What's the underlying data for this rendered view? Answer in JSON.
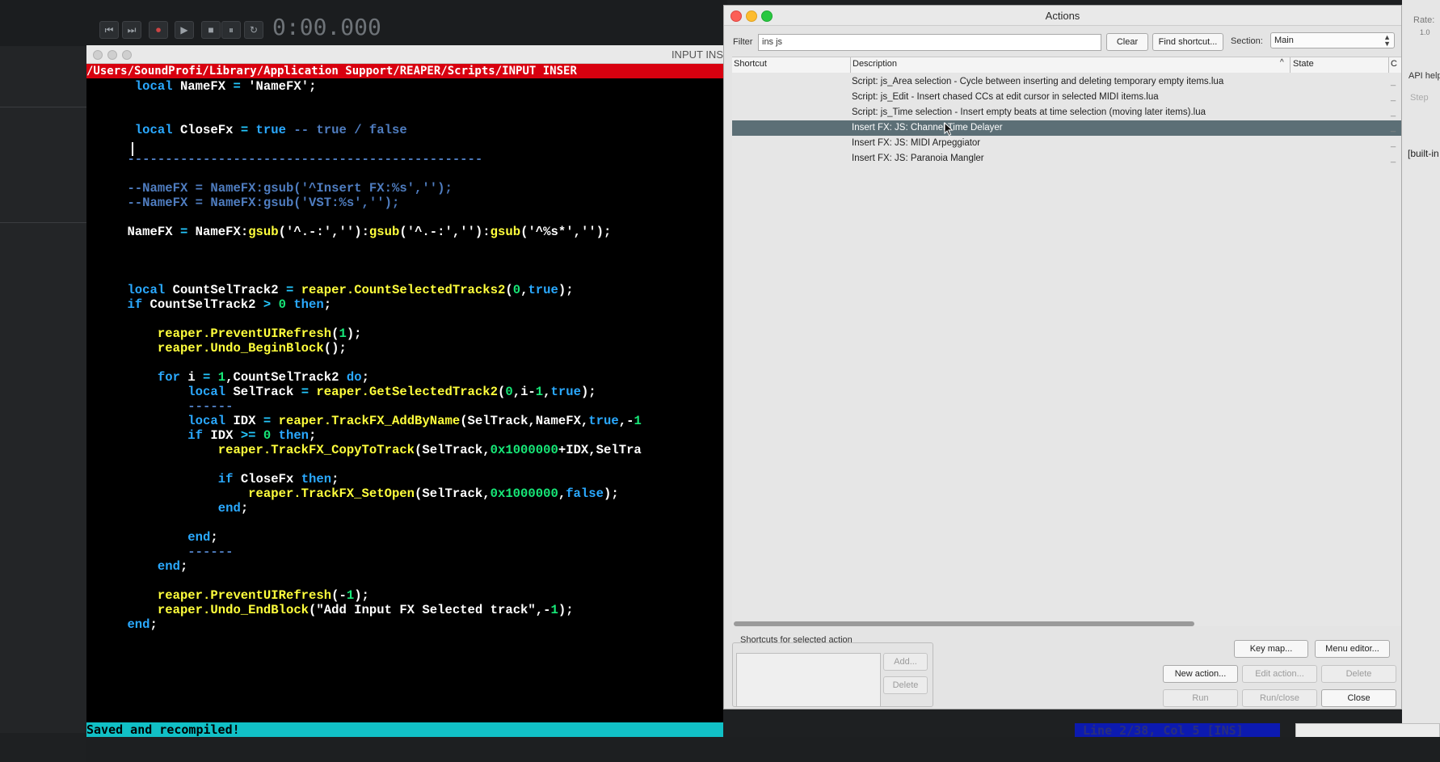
{
  "transport": {
    "time": "0:00.000",
    "buttons": [
      "⏮",
      "⏭",
      "⏺",
      "▶",
      "■",
      "⏸",
      "↻"
    ]
  },
  "editor": {
    "title": "INPUT INS",
    "path": "/Users/SoundProfi/Library/Application Support/REAPER/Scripts/INPUT INSER",
    "status_left": "Saved and recompiled!",
    "status_right": "Line 2/38, Col 5 [INS]"
  },
  "code_lines": [
    {
      "indent": "     ",
      "parts": [
        [
          "kw",
          "local "
        ],
        [
          "st",
          "NameFX "
        ],
        [
          "op",
          "= "
        ],
        [
          "st",
          "'NameFX'"
        ],
        [
          "st",
          ";"
        ]
      ]
    },
    {
      "indent": "",
      "parts": []
    },
    {
      "indent": "",
      "parts": []
    },
    {
      "indent": "     ",
      "parts": [
        [
          "kw",
          "local "
        ],
        [
          "st",
          "CloseFx "
        ],
        [
          "op",
          "= "
        ],
        [
          "kw",
          "true "
        ],
        [
          "cm",
          "-- true / false"
        ]
      ]
    },
    {
      "indent": "",
      "parts": []
    },
    {
      "indent": "    ",
      "parts": [
        [
          "cm",
          "-----------------------------------------------"
        ]
      ]
    },
    {
      "indent": "",
      "parts": []
    },
    {
      "indent": "    ",
      "parts": [
        [
          "cm",
          "--NameFX = NameFX:gsub('^Insert FX:%s','');"
        ]
      ]
    },
    {
      "indent": "    ",
      "parts": [
        [
          "cm",
          "--NameFX = NameFX:gsub('VST:%s','');"
        ]
      ]
    },
    {
      "indent": "",
      "parts": []
    },
    {
      "indent": "    ",
      "parts": [
        [
          "st",
          "NameFX "
        ],
        [
          "op",
          "= "
        ],
        [
          "st",
          "NameFX:"
        ],
        [
          "fn",
          "gsub"
        ],
        [
          "st",
          "('^.-:','')"
        ],
        [
          "st",
          ":"
        ],
        [
          "fn",
          "gsub"
        ],
        [
          "st",
          "('^.-:','')"
        ],
        [
          "st",
          ":"
        ],
        [
          "fn",
          "gsub"
        ],
        [
          "st",
          "('^%s*','');"
        ]
      ]
    },
    {
      "indent": "",
      "parts": []
    },
    {
      "indent": "",
      "parts": []
    },
    {
      "indent": "",
      "parts": []
    },
    {
      "indent": "    ",
      "parts": [
        [
          "kw",
          "local "
        ],
        [
          "st",
          "CountSelTrack2 "
        ],
        [
          "op",
          "= "
        ],
        [
          "fn",
          "reaper.CountSelectedTracks2"
        ],
        [
          "st",
          "("
        ],
        [
          "nm",
          "0"
        ],
        [
          "st",
          ","
        ],
        [
          "kw",
          "true"
        ],
        [
          "st",
          ");"
        ]
      ]
    },
    {
      "indent": "    ",
      "parts": [
        [
          "kw",
          "if "
        ],
        [
          "st",
          "CountSelTrack2 "
        ],
        [
          "op",
          "> "
        ],
        [
          "nm",
          "0 "
        ],
        [
          "kw",
          "then"
        ],
        [
          "st",
          ";"
        ]
      ]
    },
    {
      "indent": "",
      "parts": []
    },
    {
      "indent": "        ",
      "parts": [
        [
          "fn",
          "reaper.PreventUIRefresh"
        ],
        [
          "st",
          "("
        ],
        [
          "nm",
          "1"
        ],
        [
          "st",
          ");"
        ]
      ]
    },
    {
      "indent": "        ",
      "parts": [
        [
          "fn",
          "reaper.Undo_BeginBlock"
        ],
        [
          "st",
          "();"
        ]
      ]
    },
    {
      "indent": "",
      "parts": []
    },
    {
      "indent": "        ",
      "parts": [
        [
          "kw",
          "for "
        ],
        [
          "st",
          "i "
        ],
        [
          "op",
          "= "
        ],
        [
          "nm",
          "1"
        ],
        [
          "st",
          ",CountSelTrack2 "
        ],
        [
          "kw",
          "do"
        ],
        [
          "st",
          ";"
        ]
      ]
    },
    {
      "indent": "            ",
      "parts": [
        [
          "kw",
          "local "
        ],
        [
          "st",
          "SelTrack "
        ],
        [
          "op",
          "= "
        ],
        [
          "fn",
          "reaper.GetSelectedTrack2"
        ],
        [
          "st",
          "("
        ],
        [
          "nm",
          "0"
        ],
        [
          "st",
          ",i-"
        ],
        [
          "nm",
          "1"
        ],
        [
          "st",
          ","
        ],
        [
          "kw",
          "true"
        ],
        [
          "st",
          ");"
        ]
      ]
    },
    {
      "indent": "            ",
      "parts": [
        [
          "cm",
          "------"
        ]
      ]
    },
    {
      "indent": "            ",
      "parts": [
        [
          "kw",
          "local "
        ],
        [
          "st",
          "IDX "
        ],
        [
          "op",
          "= "
        ],
        [
          "fn",
          "reaper.TrackFX_AddByName"
        ],
        [
          "st",
          "(SelTrack,NameFX,"
        ],
        [
          "kw",
          "true"
        ],
        [
          "st",
          ",-"
        ],
        [
          "nm",
          "1"
        ]
      ]
    },
    {
      "indent": "            ",
      "parts": [
        [
          "kw",
          "if "
        ],
        [
          "st",
          "IDX "
        ],
        [
          "op",
          ">= "
        ],
        [
          "nm",
          "0 "
        ],
        [
          "kw",
          "then"
        ],
        [
          "st",
          ";"
        ]
      ]
    },
    {
      "indent": "                ",
      "parts": [
        [
          "fn",
          "reaper.TrackFX_CopyToTrack"
        ],
        [
          "st",
          "(SelTrack,"
        ],
        [
          "nm",
          "0x1000000"
        ],
        [
          "st",
          "+IDX,SelTra"
        ]
      ]
    },
    {
      "indent": "",
      "parts": []
    },
    {
      "indent": "                ",
      "parts": [
        [
          "kw",
          "if "
        ],
        [
          "st",
          "CloseFx "
        ],
        [
          "kw",
          "then"
        ],
        [
          "st",
          ";"
        ]
      ]
    },
    {
      "indent": "                    ",
      "parts": [
        [
          "fn",
          "reaper.TrackFX_SetOpen"
        ],
        [
          "st",
          "(SelTrack,"
        ],
        [
          "nm",
          "0x1000000"
        ],
        [
          "st",
          ","
        ],
        [
          "kw",
          "false"
        ],
        [
          "st",
          ");"
        ]
      ]
    },
    {
      "indent": "                ",
      "parts": [
        [
          "kw",
          "end"
        ],
        [
          "st",
          ";"
        ]
      ]
    },
    {
      "indent": "",
      "parts": []
    },
    {
      "indent": "            ",
      "parts": [
        [
          "kw",
          "end"
        ],
        [
          "st",
          ";"
        ]
      ]
    },
    {
      "indent": "            ",
      "parts": [
        [
          "cm",
          "------"
        ]
      ]
    },
    {
      "indent": "        ",
      "parts": [
        [
          "kw",
          "end"
        ],
        [
          "st",
          ";"
        ]
      ]
    },
    {
      "indent": "",
      "parts": []
    },
    {
      "indent": "        ",
      "parts": [
        [
          "fn",
          "reaper.PreventUIRefresh"
        ],
        [
          "st",
          "(-"
        ],
        [
          "nm",
          "1"
        ],
        [
          "st",
          ");"
        ]
      ]
    },
    {
      "indent": "        ",
      "parts": [
        [
          "fn",
          "reaper.Undo_EndBlock"
        ],
        [
          "st",
          "(\"Add Input FX Selected track\",-"
        ],
        [
          "nm",
          "1"
        ],
        [
          "st",
          ");"
        ]
      ]
    },
    {
      "indent": "    ",
      "parts": [
        [
          "kw",
          "end"
        ],
        [
          "st",
          ";"
        ]
      ]
    }
  ],
  "actions": {
    "title": "Actions",
    "filter_label": "Filter",
    "filter_value": "ins js",
    "clear": "Clear",
    "find_shortcut": "Find shortcut...",
    "section_label": "Section:",
    "section_value": "Main",
    "columns": {
      "shortcut": "Shortcut",
      "description": "Description",
      "state": "State",
      "extra": "C"
    },
    "rows": [
      {
        "description": "Script: js_Area selection - Cycle between inserting and deleting temporary empty items.lua",
        "selected": false
      },
      {
        "description": "Script: js_Edit - Insert chased CCs at edit cursor in selected MIDI items.lua",
        "selected": false
      },
      {
        "description": "Script: js_Time selection - Insert empty beats at time selection (moving later items).lua",
        "selected": false
      },
      {
        "description": "Insert FX: JS: Channel Time Delayer",
        "selected": true
      },
      {
        "description": "Insert FX: JS: MIDI Arpeggiator",
        "selected": false
      },
      {
        "description": "Insert FX: JS: Paranoia Mangler",
        "selected": false
      }
    ],
    "shortcuts_label": "Shortcuts for selected action",
    "add": "Add...",
    "delete": "Delete",
    "key_map": "Key map...",
    "menu_editor": "Menu editor...",
    "new_action": "New action...",
    "edit_action": "Edit action...",
    "delete2": "Delete",
    "run": "Run",
    "run_close": "Run/close",
    "close": "Close"
  },
  "side_panel": {
    "rate": "Rate:",
    "rate_val": "1.0",
    "api_help": "API help",
    "step": "Step",
    "built_in": "[built-in"
  },
  "colors": {
    "selection": "#5c6f76",
    "status": "#11c0c6",
    "path_bar": "#d8000f"
  }
}
